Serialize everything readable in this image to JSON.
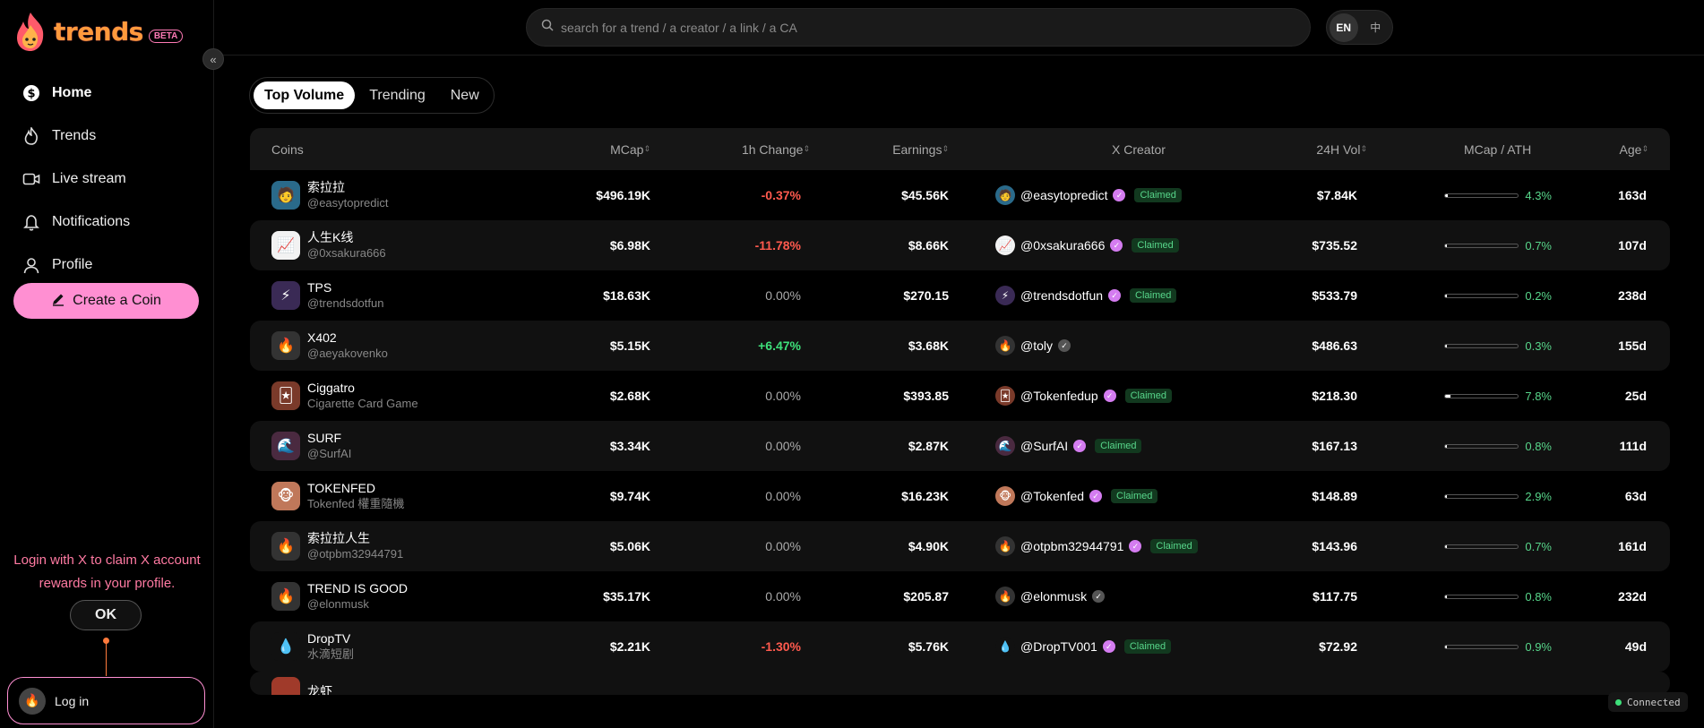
{
  "app": {
    "logo_text": "trends",
    "beta_label": "BETA",
    "collapse_icon": "«"
  },
  "sidebar": {
    "items": [
      {
        "label": "Home",
        "icon": "dollar-icon"
      },
      {
        "label": "Trends",
        "icon": "flame-icon"
      },
      {
        "label": "Live stream",
        "icon": "video-icon"
      },
      {
        "label": "Notifications",
        "icon": "bell-icon"
      },
      {
        "label": "Profile",
        "icon": "user-icon"
      }
    ],
    "create_label": "Create a Coin",
    "login_tip": "Login with X to claim X account rewards in your profile.",
    "ok_label": "OK",
    "login_label": "Log in"
  },
  "search": {
    "placeholder": "search for a trend / a creator / a link / a CA"
  },
  "lang": {
    "en": "EN",
    "zh": "中"
  },
  "tabs": [
    "Top Volume",
    "Trending",
    "New"
  ],
  "table": {
    "headers": {
      "coins": "Coins",
      "mcap": "MCap",
      "change": "1h Change",
      "earnings": "Earnings",
      "creator": "X Creator",
      "vol": "24H Vol",
      "ath": "MCap / ATH",
      "age": "Age"
    },
    "rows": [
      {
        "name": "索拉拉",
        "sub": "@easytopredict",
        "mcap": "$496.19K",
        "change": "-0.37%",
        "dir": "neg",
        "earnings": "$45.56K",
        "creator": "@easytopredict",
        "claimed": true,
        "vol": "$7.84K",
        "ath": "4.3%",
        "ath_pct": 4.3,
        "age": "163d",
        "img": "🧑",
        "bg": "#2a6a8a"
      },
      {
        "name": "人生K线",
        "sub": "@0xsakura666",
        "mcap": "$6.98K",
        "change": "-11.78%",
        "dir": "neg",
        "earnings": "$8.66K",
        "creator": "@0xsakura666",
        "claimed": true,
        "vol": "$735.52",
        "ath": "0.7%",
        "ath_pct": 0.7,
        "age": "107d",
        "img": "📈",
        "bg": "#f2f2f2"
      },
      {
        "name": "TPS",
        "sub": "@trendsdotfun",
        "mcap": "$18.63K",
        "change": "0.00%",
        "dir": "zero",
        "earnings": "$270.15",
        "creator": "@trendsdotfun",
        "claimed": true,
        "vol": "$533.79",
        "ath": "0.2%",
        "ath_pct": 0.2,
        "age": "238d",
        "img": "⚡",
        "bg": "#3a2a55"
      },
      {
        "name": "X402",
        "sub": "@aeyakovenko",
        "mcap": "$5.15K",
        "change": "+6.47%",
        "dir": "pos",
        "earnings": "$3.68K",
        "creator": "@toly",
        "claimed": false,
        "vol": "$486.63",
        "ath": "0.3%",
        "ath_pct": 0.3,
        "age": "155d",
        "img": "🔥",
        "bg": "#333"
      },
      {
        "name": "Ciggatro",
        "sub": "Cigarette Card Game",
        "mcap": "$2.68K",
        "change": "0.00%",
        "dir": "zero",
        "earnings": "$393.85",
        "creator": "@Tokenfedup",
        "claimed": true,
        "vol": "$218.30",
        "ath": "7.8%",
        "ath_pct": 7.8,
        "age": "25d",
        "img": "🃏",
        "bg": "#7a3a2a"
      },
      {
        "name": "SURF",
        "sub": "@SurfAI",
        "mcap": "$3.34K",
        "change": "0.00%",
        "dir": "zero",
        "earnings": "$2.87K",
        "creator": "@SurfAI",
        "claimed": true,
        "vol": "$167.13",
        "ath": "0.8%",
        "ath_pct": 0.8,
        "age": "111d",
        "img": "🌊",
        "bg": "#4a2a40"
      },
      {
        "name": "TOKENFED",
        "sub": "Tokenfed 權重隨機",
        "mcap": "$9.74K",
        "change": "0.00%",
        "dir": "zero",
        "earnings": "$16.23K",
        "creator": "@Tokenfed",
        "claimed": true,
        "vol": "$148.89",
        "ath": "2.9%",
        "ath_pct": 2.9,
        "age": "63d",
        "img": "🐵",
        "bg": "#c0785a"
      },
      {
        "name": "索拉拉人生",
        "sub": "@otpbm32944791",
        "mcap": "$5.06K",
        "change": "0.00%",
        "dir": "zero",
        "earnings": "$4.90K",
        "creator": "@otpbm32944791",
        "claimed": true,
        "vol": "$143.96",
        "ath": "0.7%",
        "ath_pct": 0.7,
        "age": "161d",
        "img": "🔥",
        "bg": "#333"
      },
      {
        "name": "TREND IS GOOD",
        "sub": "@elonmusk",
        "mcap": "$35.17K",
        "change": "0.00%",
        "dir": "zero",
        "earnings": "$205.87",
        "creator": "@elonmusk",
        "claimed": false,
        "vol": "$117.75",
        "ath": "0.8%",
        "ath_pct": 0.8,
        "age": "232d",
        "img": "🔥",
        "bg": "#333"
      },
      {
        "name": "DropTV",
        "sub": "水滴短剧",
        "mcap": "$2.21K",
        "change": "-1.30%",
        "dir": "neg",
        "earnings": "$5.76K",
        "creator": "@DropTV001",
        "claimed": true,
        "vol": "$72.92",
        "ath": "0.9%",
        "ath_pct": 0.9,
        "age": "49d",
        "img": "💧",
        "bg": "#111"
      }
    ],
    "partial_row": {
      "name": "龙虾"
    },
    "claimed_label": "Claimed"
  },
  "status": {
    "connected": "Connected"
  }
}
